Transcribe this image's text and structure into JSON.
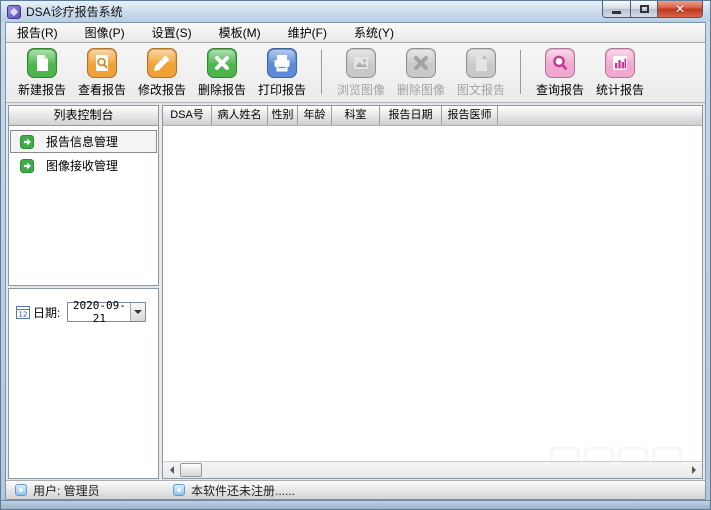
{
  "window": {
    "title": "DSA诊疗报告系统"
  },
  "menu_bar": {
    "items": [
      {
        "label": "报告(R)"
      },
      {
        "label": "图像(P)"
      },
      {
        "label": "设置(S)"
      },
      {
        "label": "模板(M)"
      },
      {
        "label": "维护(F)"
      },
      {
        "label": "系统(Y)"
      }
    ]
  },
  "toolbar": {
    "report_group": [
      {
        "label": "新建报告",
        "icon": "new-report-icon",
        "color": "#4cb64c",
        "disabled": false
      },
      {
        "label": "查看报告",
        "icon": "view-report-icon",
        "color": "#f0a238",
        "disabled": false
      },
      {
        "label": "修改报告",
        "icon": "edit-report-icon",
        "color": "#f0a238",
        "disabled": false
      },
      {
        "label": "删除报告",
        "icon": "delete-report-icon",
        "color": "#4cb64c",
        "disabled": false
      },
      {
        "label": "打印报告",
        "icon": "print-report-icon",
        "color": "#5a8ad8",
        "disabled": false
      }
    ],
    "image_group": [
      {
        "label": "浏览图像",
        "icon": "browse-image-icon",
        "color": "#c9c9c9",
        "disabled": true
      },
      {
        "label": "删除图像",
        "icon": "delete-image-icon",
        "color": "#c9c9c9",
        "disabled": true
      },
      {
        "label": "图文报告",
        "icon": "image-text-report-icon",
        "color": "#c9c9c9",
        "disabled": true
      }
    ],
    "query_group": [
      {
        "label": "查询报告",
        "icon": "query-report-icon",
        "color": "#f0a8d0",
        "disabled": false
      },
      {
        "label": "统计报告",
        "icon": "stats-report-icon",
        "color": "#f0a8d0",
        "disabled": false
      }
    ]
  },
  "sidebar": {
    "header": "列表控制台",
    "items": [
      {
        "label": "报告信息管理",
        "selected": true
      },
      {
        "label": "图像接收管理",
        "selected": false
      }
    ],
    "date_label": "日期:",
    "date_value": "2020-09-21"
  },
  "table": {
    "columns": [
      "DSA号",
      "病人姓名",
      "性别",
      "年龄",
      "科室",
      "报告日期",
      "报告医师"
    ],
    "rows": []
  },
  "status_bar": {
    "user_label": "用户: 管理员",
    "register_notice": "本软件还未注册......"
  },
  "colors": {
    "accent_green": "#4cb64c",
    "accent_orange": "#f0a238",
    "accent_blue": "#5a8ad8",
    "accent_pink": "#f0a8d0",
    "pink_deep": "#c73a93",
    "disabled_gray": "#c9c9c9",
    "close_button_red": "#bf3420",
    "titlebar_top": "#e8f1fa"
  }
}
